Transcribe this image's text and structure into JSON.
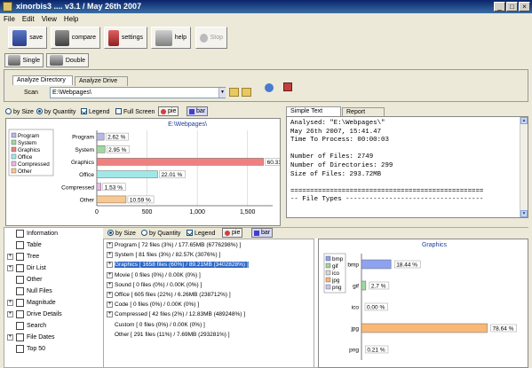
{
  "window": {
    "title": "xinorbis3 .... v3.1 / May 26th 2007",
    "min": "_",
    "max": "□",
    "close": "×"
  },
  "menu": [
    "File",
    "Edit",
    "View",
    "Help"
  ],
  "toolbar": {
    "save": "save",
    "compare": "compare",
    "settings": "settings",
    "help": "help",
    "stop": "Stop"
  },
  "modes": {
    "single": "Single",
    "double": "Double"
  },
  "analyze": {
    "tab_dir": "Analyze Directory",
    "tab_drive": "Analyze Drive",
    "scan_label": "Scan",
    "scan_value": "E:\\Webpages\\"
  },
  "chart_opts": {
    "by_size": "by Size",
    "by_quantity": "by Quantity",
    "legend": "Legend",
    "full_screen": "Full Screen",
    "pie": "pie",
    "bar": "bar"
  },
  "chart_data": [
    {
      "type": "bar",
      "title": "E:\\Webpages\\",
      "categories": [
        "Program",
        "System",
        "Graphics",
        "Office",
        "Compressed",
        "Other"
      ],
      "values": [
        2.62,
        2.95,
        60.31,
        22.01,
        1.53,
        10.59
      ],
      "labels": [
        "2.62 %",
        "2.95 %",
        "60.31 %",
        "22.01 %",
        "1.53 %",
        "10.59 %"
      ],
      "counts": [
        72,
        81,
        1658,
        605,
        42,
        291
      ],
      "xticks": [
        "0",
        "500",
        "1,000",
        "1,500"
      ],
      "xlim": [
        0,
        1750
      ],
      "legend": [
        "Program",
        "System",
        "Graphics",
        "Office",
        "Compressed",
        "Other"
      ],
      "colors": [
        "#b8b8e8",
        "#a0d8a0",
        "#f08080",
        "#a0e8e8",
        "#e8b8e8",
        "#f8c890"
      ]
    },
    {
      "type": "bar",
      "title": "Graphics",
      "categories": [
        "bmp",
        "gif",
        "ico",
        "jpg",
        "png"
      ],
      "values": [
        18.44,
        2.7,
        0.0,
        78.64,
        0.21
      ],
      "labels": [
        "18.44 %",
        "2.7 %",
        "0.00 %",
        "78.64 %",
        "0.21 %"
      ],
      "legend": [
        "bmp",
        "gif",
        "ico",
        "jpg",
        "png"
      ],
      "colors": [
        "#8fa2f0",
        "#a0d8a0",
        "#d8d8d8",
        "#f8b878",
        "#c8c8f8"
      ]
    }
  ],
  "report": {
    "tab_simple": "Simple Text Report",
    "tab_browser": "Report Browser",
    "lines": [
      "Analysed: \"E:\\Webpages\\\"",
      "May 26th 2007, 15:41.47",
      "Time To Process: 00:00:03",
      "",
      "Number of Files: 2749",
      "Number of Directories: 299",
      "Size of Files: 293.72MB",
      "",
      "=================================================",
      "-- File Types -----------------------------------"
    ]
  },
  "tree": [
    {
      "label": "Information",
      "expander": ""
    },
    {
      "label": "Table",
      "expander": ""
    },
    {
      "label": "Tree",
      "expander": "+"
    },
    {
      "label": "Dir List",
      "expander": "+"
    },
    {
      "label": "Other",
      "expander": ""
    },
    {
      "label": "Null Files",
      "expander": ""
    },
    {
      "label": "Magnitude",
      "expander": "+"
    },
    {
      "label": "Drive Details",
      "expander": "+"
    },
    {
      "label": "Search",
      "expander": ""
    },
    {
      "label": "File Dates",
      "expander": "+"
    },
    {
      "label": "Top 50",
      "expander": ""
    }
  ],
  "lower_opts": {
    "by_size": "by Size",
    "by_quantity": "by Quantity",
    "legend": "Legend",
    "pie": "pie",
    "bar": "bar"
  },
  "filetypes": [
    {
      "label": "Program [ 72 files (3%) / 177.65MB (6776298%) ]",
      "exp": "+"
    },
    {
      "label": "System [ 81 files (3%) / 82.57K (3076%) ]",
      "exp": "+"
    },
    {
      "label": "Graphics [ 1658 files (60%) / 89.21MB (3402828%) ]",
      "exp": "+"
    },
    {
      "label": "Movie [ 0 files (0%) / 0.00K (0%) ]",
      "exp": "+"
    },
    {
      "label": "Sound [ 0 files (0%) / 0.00K (0%) ]",
      "exp": "+"
    },
    {
      "label": "Office [ 605 files (22%) / 6.26MB (238712%) ]",
      "exp": "+"
    },
    {
      "label": "Code [ 0 files (0%) / 0.00K (0%) ]",
      "exp": "+"
    },
    {
      "label": "Compressed [ 42 files (2%) / 12.83MB (489248%) ]",
      "exp": "+"
    },
    {
      "label": "Custom [ 0 files (0%) / 0.00K (0%) ]",
      "exp": ""
    },
    {
      "label": "Other [ 291 files (11%) / 7.69MB (293281%) ]",
      "exp": ""
    }
  ]
}
